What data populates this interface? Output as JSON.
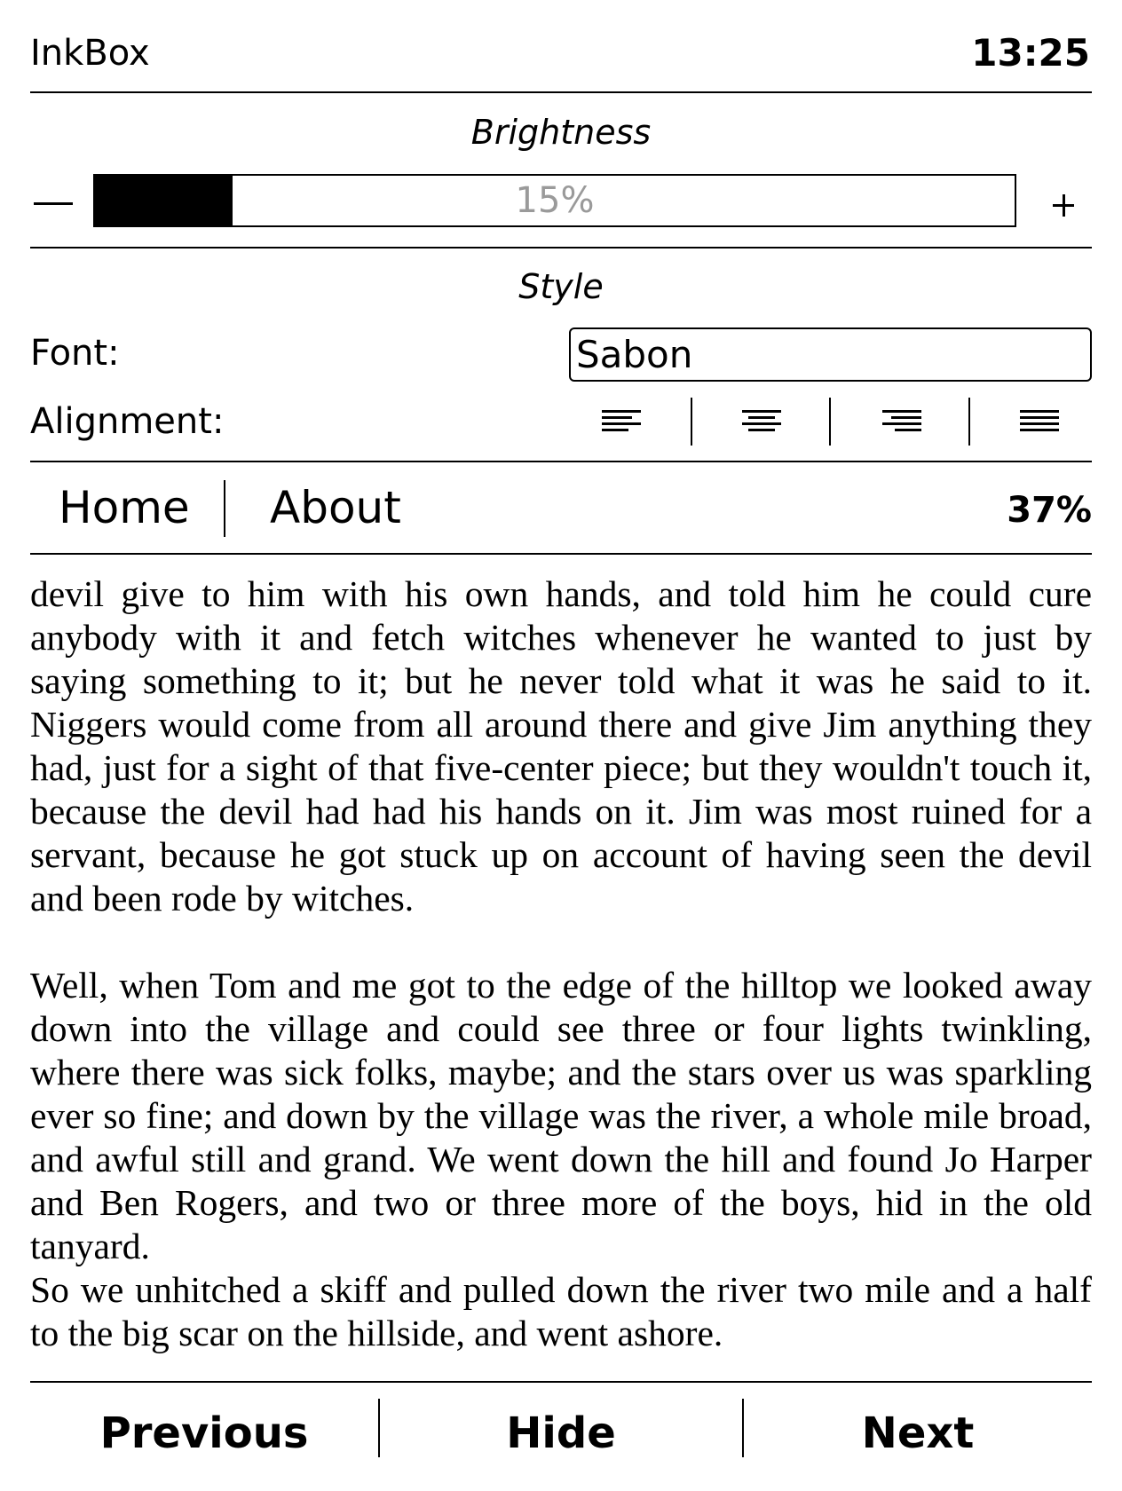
{
  "status_bar": {
    "app_name": "InkBox",
    "time": "13:25"
  },
  "brightness": {
    "title": "Brightness",
    "value_percent": 15,
    "label": "15%",
    "decrease_icon": "minus-icon",
    "increase_icon": "plus-icon"
  },
  "style": {
    "title": "Style",
    "font_label": "Font:",
    "font_value": "Sabon",
    "alignment_label": "Alignment:",
    "alignment_options": [
      "align-left-icon",
      "align-center-icon",
      "align-right-icon",
      "align-justify-icon"
    ]
  },
  "tabs": {
    "home": "Home",
    "about": "About",
    "progress": "37%"
  },
  "reader": {
    "paragraphs": [
      "devil give to him with his own hands, and told him he could cure anybody with it and fetch witches whenever he wanted to just by saying something to it; but he never told what it was he said to it. Niggers would come from all around there and give Jim anything they had, just for a sight of that five-center piece; but they wouldn't touch it, because the devil had had his hands on it. Jim was most ruined for a servant, because he got stuck up on account of having seen the devil and been rode by witches.",
      "Well, when Tom and me got to the edge of the hilltop we looked away down into the village and could see three or four lights twinkling, where there was sick folks, maybe; and the stars over us was sparkling ever so fine; and down by the village was the river, a whole mile broad, and awful still and grand. We went down the hill and found Jo Harper and Ben Rogers, and two or three more of the boys, hid in the old tanyard.",
      "So we unhitched a skiff and pulled down the river two mile and a half to the big scar on the hillside, and went ashore."
    ]
  },
  "navigation": {
    "previous": "Previous",
    "hide": "Hide",
    "next": "Next"
  }
}
